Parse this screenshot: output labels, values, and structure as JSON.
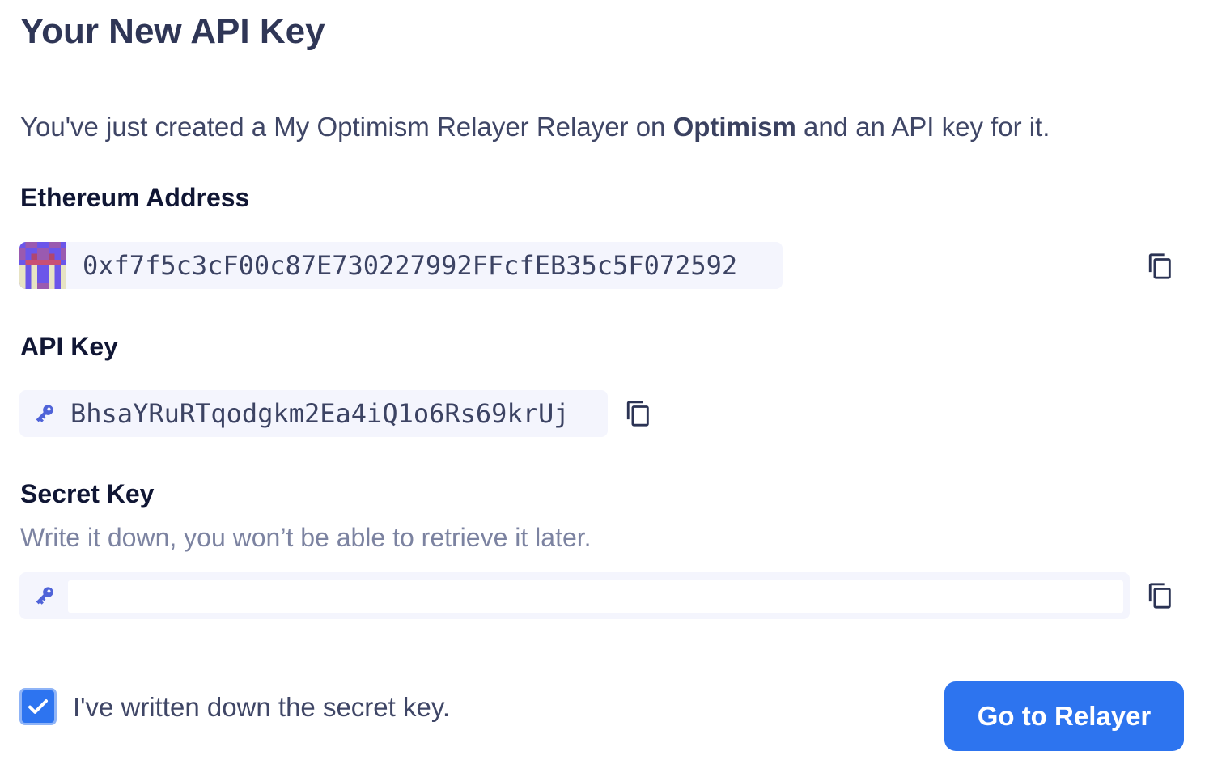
{
  "page": {
    "title": "Your New API Key"
  },
  "intro": {
    "prefix": "You've just created a My Optimism Relayer Relayer on ",
    "network": "Optimism",
    "suffix": " and an API key for it."
  },
  "ethereum_address": {
    "label": "Ethereum Address",
    "value": "0xf7f5c3cF00c87E730227992FFcfEB35c5F072592",
    "avatar_icon": "identicon-avatar",
    "copy_icon": "copy-icon"
  },
  "api_key": {
    "label": "API Key",
    "value": "BhsaYRuRTqodgkm2Ea4iQ1o6Rs69krUj",
    "icon": "key-icon",
    "copy_icon": "copy-icon"
  },
  "secret_key": {
    "label": "Secret Key",
    "hint": "Write it down, you won’t be able to retrieve it later.",
    "value": "",
    "icon": "key-icon",
    "copy_icon": "copy-icon"
  },
  "confirm": {
    "label": "I've written down the secret key.",
    "checked": true
  },
  "actions": {
    "primary_label": "Go to Relayer"
  },
  "colors": {
    "accent": "#2d74ef",
    "field_bg": "#f4f5fd",
    "key_icon": "#4f63d8",
    "heading": "#101634",
    "muted": "#7c83a1"
  }
}
